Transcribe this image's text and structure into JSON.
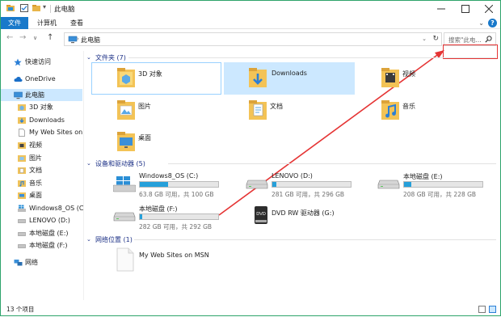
{
  "window": {
    "title": "此电脑"
  },
  "ribbon": {
    "tabs": [
      "文件",
      "计算机",
      "查看"
    ],
    "help": "?"
  },
  "nav": {
    "address": "此电脑",
    "search_placeholder": "搜索\"此电..."
  },
  "sidebar": {
    "items": [
      {
        "label": "快速访问",
        "icon": "star-icon"
      },
      {
        "label": "OneDrive",
        "icon": "cloud-icon"
      },
      {
        "label": "此电脑",
        "icon": "computer-icon",
        "selected": true
      },
      {
        "label": "3D 对象",
        "icon": "3d-folder-icon"
      },
      {
        "label": "Downloads",
        "icon": "download-folder-icon"
      },
      {
        "label": "My Web Sites on I",
        "icon": "document-icon"
      },
      {
        "label": "视频",
        "icon": "video-folder-icon"
      },
      {
        "label": "图片",
        "icon": "pictures-folder-icon"
      },
      {
        "label": "文档",
        "icon": "documents-folder-icon"
      },
      {
        "label": "音乐",
        "icon": "music-folder-icon"
      },
      {
        "label": "桌面",
        "icon": "desktop-folder-icon"
      },
      {
        "label": "Windows8_OS (C:)",
        "icon": "windows-drive-icon"
      },
      {
        "label": "LENOVO (D:)",
        "icon": "drive-icon"
      },
      {
        "label": "本地磁盘 (E:)",
        "icon": "drive-icon"
      },
      {
        "label": "本地磁盘 (F:)",
        "icon": "drive-icon"
      },
      {
        "label": "网络",
        "icon": "network-icon"
      }
    ]
  },
  "folders": {
    "header": "文件夹 (7)",
    "items": [
      {
        "label": "3D 对象",
        "icon": "3d-folder-icon"
      },
      {
        "label": "Downloads",
        "icon": "download-folder-icon"
      },
      {
        "label": "视频",
        "icon": "video-folder-icon"
      },
      {
        "label": "图片",
        "icon": "pictures-folder-icon"
      },
      {
        "label": "文档",
        "icon": "documents-folder-icon"
      },
      {
        "label": "音乐",
        "icon": "music-folder-icon"
      },
      {
        "label": "桌面",
        "icon": "desktop-folder-icon"
      }
    ]
  },
  "drives": {
    "header": "设备和驱动器 (5)",
    "items": [
      {
        "name": "Windows8_OS (C:)",
        "capacity": "63.8 GB 可用，共 100 GB",
        "used_fraction": 0.362
      },
      {
        "name": "LENOVO (D:)",
        "capacity": "281 GB 可用，共 296 GB",
        "used_fraction": 0.05
      },
      {
        "name": "本地磁盘 (E:)",
        "capacity": "208 GB 可用，共 228 GB",
        "used_fraction": 0.088
      },
      {
        "name": "本地磁盘 (F:)",
        "capacity": "282 GB 可用，共 292 GB",
        "used_fraction": 0.034
      },
      {
        "name": "DVD RW 驱动器 (G:)",
        "capacity": ""
      }
    ]
  },
  "network": {
    "header": "网络位置 (1)",
    "items": [
      {
        "label": "My Web Sites on MSN"
      }
    ]
  },
  "status": {
    "count": "13 个项目"
  },
  "colors": {
    "accent": "#1979ca",
    "annotation": "#e53434",
    "selection": "#cce8ff",
    "bar_fill": "#26a0da"
  }
}
